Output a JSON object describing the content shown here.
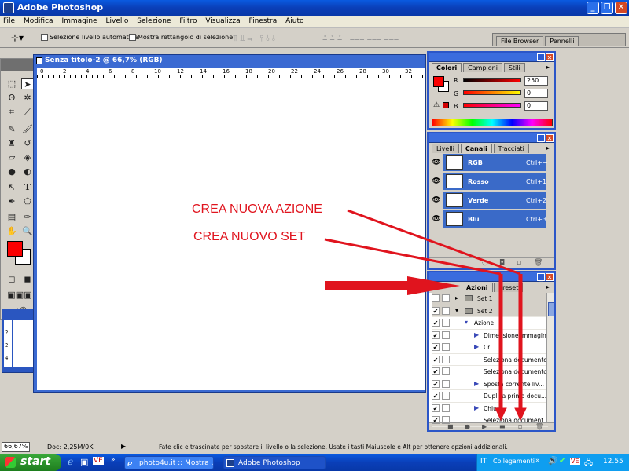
{
  "app": {
    "title": "Adobe Photoshop"
  },
  "menu": [
    "File",
    "Modifica",
    "Immagine",
    "Livello",
    "Selezione",
    "Filtro",
    "Visualizza",
    "Finestra",
    "Aiuto"
  ],
  "options": {
    "auto_select_label": "Selezione livello automatica",
    "show_rect_label": "Mostra rettangolo di selezione"
  },
  "palette_well": {
    "tabs": [
      "File Browser",
      "Pennelli"
    ]
  },
  "document": {
    "title": "Senza titolo-2 @ 66,7% (RGB)",
    "ruler_labels": [
      "0",
      "2",
      "4",
      "6",
      "8",
      "10",
      "12",
      "14",
      "16",
      "18",
      "20",
      "22",
      "24",
      "26",
      "28",
      "30",
      "32"
    ],
    "side_ruler_labels": [
      "2",
      "2",
      "4"
    ]
  },
  "color_panel": {
    "tabs": [
      "Colori",
      "Campioni",
      "Stili"
    ],
    "sliders": [
      {
        "label": "R",
        "value": "250"
      },
      {
        "label": "G",
        "value": "0"
      },
      {
        "label": "B",
        "value": "0"
      }
    ],
    "foreground_color": "#fa0000"
  },
  "channels_panel": {
    "tabs": [
      "Livelli",
      "Canali",
      "Tracciati"
    ],
    "rows": [
      {
        "name": "RGB",
        "shortcut": "Ctrl+~"
      },
      {
        "name": "Rosso",
        "shortcut": "Ctrl+1"
      },
      {
        "name": "Verde",
        "shortcut": "Ctrl+2"
      },
      {
        "name": "Blu",
        "shortcut": "Ctrl+3"
      }
    ]
  },
  "actions_panel": {
    "tabs": [
      "Azioni",
      "Preset"
    ],
    "rows": [
      {
        "label": "Set 1",
        "type": "set",
        "checked": false
      },
      {
        "label": "Set 2",
        "type": "set",
        "checked": true
      },
      {
        "label": "Azione",
        "type": "action",
        "checked": true
      },
      {
        "label": "Dimensione immagine",
        "type": "step",
        "checked": true
      },
      {
        "label": "Cr",
        "type": "step",
        "checked": true
      },
      {
        "label": "Seleziona documento",
        "type": "step",
        "checked": true
      },
      {
        "label": "Seleziona documento",
        "type": "step",
        "checked": true
      },
      {
        "label": "Sposta corrente liv...",
        "type": "step",
        "checked": true
      },
      {
        "label": "Duplica primo docu...",
        "type": "step",
        "checked": true
      },
      {
        "label": "Chiudi",
        "type": "step",
        "checked": true
      },
      {
        "label": "Seleziona document",
        "type": "step",
        "checked": true
      }
    ]
  },
  "annotations": {
    "new_action": "CREA NUOVA AZIONE",
    "new_set": "CREA NUOVO SET"
  },
  "status": {
    "zoom": "66,67%",
    "doc": "Doc: 2,25M/0K",
    "hint": "Fate clic e trascinate per spostare il livello o la selezione.  Usate i tasti Maiuscole e Alt per ottenere opzioni addizionali."
  },
  "taskbar": {
    "start": "start",
    "tasks": [
      "photo4u.it :: Mostra ...",
      "Adobe Photoshop"
    ],
    "lang": "IT",
    "links": "Collegamenti",
    "clock": "12.55"
  },
  "colors": {
    "accent": "#e0141e",
    "panel_blue": "#3a6ac8"
  }
}
